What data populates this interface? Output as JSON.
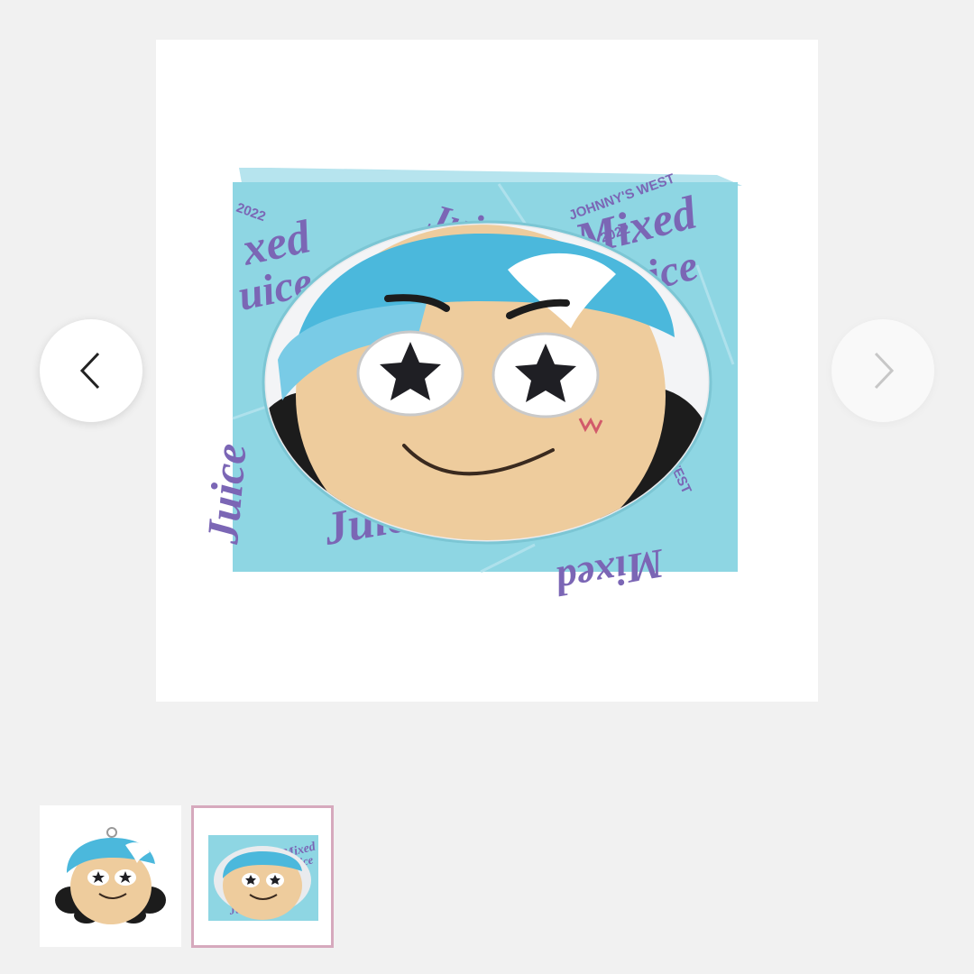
{
  "gallery": {
    "main_image": {
      "box_text": [
        "Mixed",
        "Juice",
        "JOHNNY'S WEST",
        "2022"
      ]
    },
    "prev_icon": "chevron-left-icon",
    "next_icon": "chevron-right-icon",
    "thumbnails": [
      {
        "name": "plush-front"
      },
      {
        "name": "plush-in-box",
        "selected": true
      }
    ],
    "colors": {
      "box": "#8ed6e3",
      "box_print": "#7b66b5",
      "cap": "#4bb8dc",
      "face": "#eecc9d",
      "selected_border": "#d6a9bd"
    }
  }
}
